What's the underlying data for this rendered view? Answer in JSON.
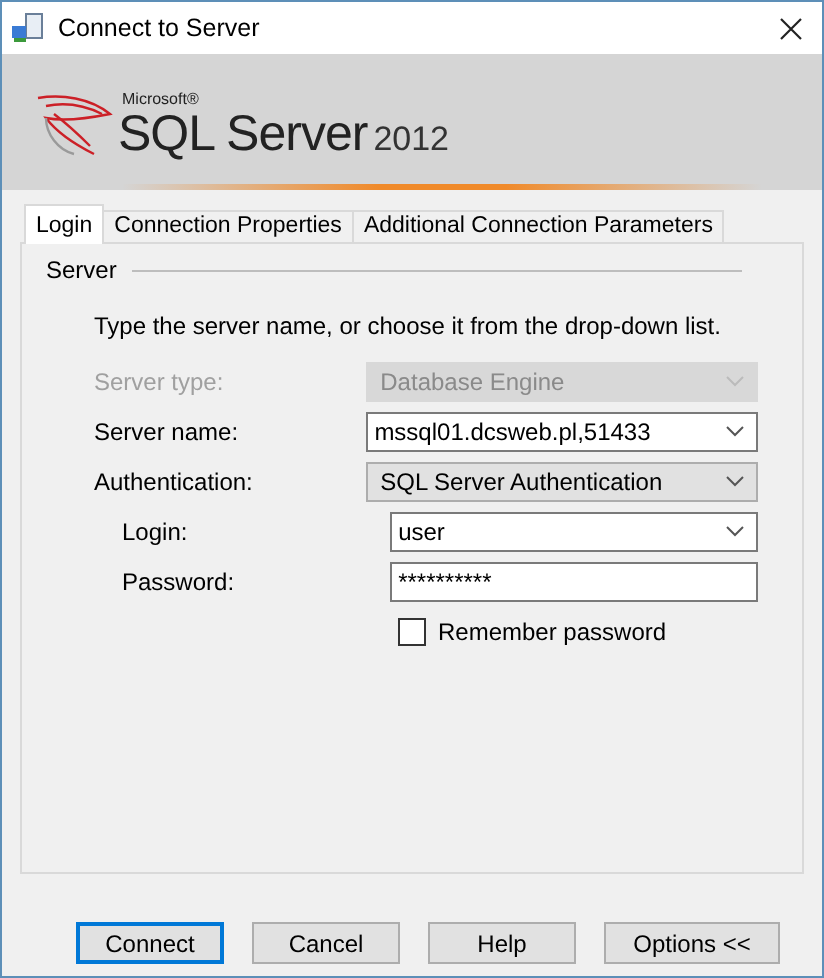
{
  "window": {
    "title": "Connect to Server"
  },
  "banner": {
    "brand": "Microsoft®",
    "product": "SQL Server",
    "version": "2012"
  },
  "tabs": [
    {
      "label": "Login",
      "selected": true
    },
    {
      "label": "Connection Properties",
      "selected": false
    },
    {
      "label": "Additional Connection Parameters",
      "selected": false
    }
  ],
  "group": {
    "title": "Server",
    "instruction": "Type the server name, or choose it from the drop-down list."
  },
  "fields": [
    {
      "label": "Server type:",
      "kind": "combo",
      "value": "Database Engine",
      "disabled": true
    },
    {
      "label": "Server name:",
      "kind": "combo",
      "value": "mssql01.dcsweb.pl,51433",
      "disabled": false
    },
    {
      "label": "Authentication:",
      "kind": "dropdown",
      "value": "SQL Server Authentication",
      "disabled": false
    }
  ],
  "credentials": [
    {
      "label": "Login:",
      "kind": "combo",
      "value": "user",
      "disabled": false
    },
    {
      "label": "Password:",
      "kind": "text",
      "value": "**********",
      "disabled": false
    }
  ],
  "remember": {
    "label": "Remember password",
    "checked": false
  },
  "buttons": [
    {
      "label": "Connect",
      "default": true
    },
    {
      "label": "Cancel",
      "default": false
    },
    {
      "label": "Help",
      "default": false
    },
    {
      "label": "Options <<",
      "default": false
    }
  ]
}
